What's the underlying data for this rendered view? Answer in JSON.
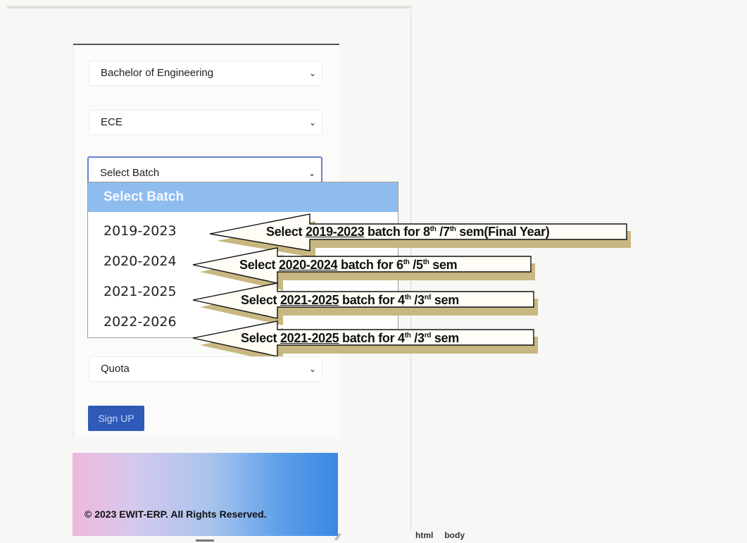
{
  "form": {
    "degree_value": "Bachelor of Engineering",
    "branch_value": "ECE",
    "batch_value": "Select Batch",
    "quota_value": "Quota",
    "signup_label": "Sign UP"
  },
  "batch_dropdown": {
    "header": "Select Batch",
    "options": [
      "2019-2023",
      "2020-2024",
      "2021-2025",
      "2022-2026"
    ]
  },
  "annotations": [
    {
      "prefix": "Select ",
      "batch": "2019-2023",
      "mid": " batch for 8",
      "sup1": "th",
      "sep": " /7",
      "sup2": "th",
      "suffix": " sem(Final Year)"
    },
    {
      "prefix": "Select ",
      "batch": "2020-2024",
      "mid": " batch for 6",
      "sup1": "th",
      "sep": " /5",
      "sup2": "th",
      "suffix": " sem"
    },
    {
      "prefix": "Select ",
      "batch": "2021-2025",
      "mid": " batch for 4",
      "sup1": "th",
      "sep": " /3",
      "sup2": "rd",
      "suffix": " sem"
    },
    {
      "prefix": "Select ",
      "batch": "2021-2025",
      "mid": " batch for 4",
      "sup1": "th",
      "sep": " /3",
      "sup2": "rd",
      "suffix": " sem"
    }
  ],
  "footer": {
    "copyright": "© 2023 EWIT-ERP. All Rights Reserved."
  },
  "status_bar": {
    "crumbs": [
      "html",
      "body"
    ]
  },
  "colors": {
    "dropdown_header": "#8fbcee",
    "signup_button": "#2f5ab8",
    "arrow_shadow": "#c8b780"
  }
}
